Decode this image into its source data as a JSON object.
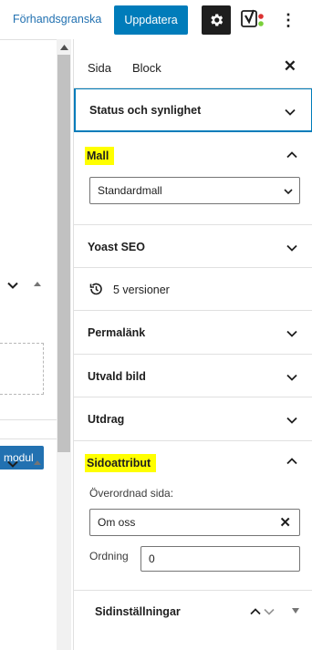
{
  "toolbar": {
    "preview_label": "Förhandsgranska",
    "update_label": "Uppdatera",
    "settings_icon": "gear-icon",
    "yoast_icon": "yoast-icon",
    "more_label": "⋮"
  },
  "editor_left": {
    "button_label": "modul"
  },
  "sidebar": {
    "tabs": [
      {
        "label": "Sida",
        "active": true
      },
      {
        "label": "Block",
        "active": false
      }
    ],
    "close_label": "✕",
    "panels": {
      "status": {
        "title": "Status och synlighet"
      },
      "template": {
        "title": "Mall",
        "select_value": "Standardmall"
      },
      "yoast": {
        "title": "Yoast SEO"
      },
      "revisions": {
        "label": "5 versioner"
      },
      "permalink": {
        "title": "Permalänk"
      },
      "featured_image": {
        "title": "Utvald bild"
      },
      "excerpt": {
        "title": "Utdrag"
      },
      "page_attributes": {
        "title": "Sidoattribut",
        "parent_label": "Överordnad sida:",
        "parent_value": "Om oss",
        "order_label": "Ordning",
        "order_value": "0"
      },
      "page_settings": {
        "title": "Sidinställningar"
      }
    }
  },
  "colors": {
    "accent": "#007cba",
    "highlight": "#ffff00",
    "text": "#1e1e1e",
    "border": "#e0e0e0"
  }
}
